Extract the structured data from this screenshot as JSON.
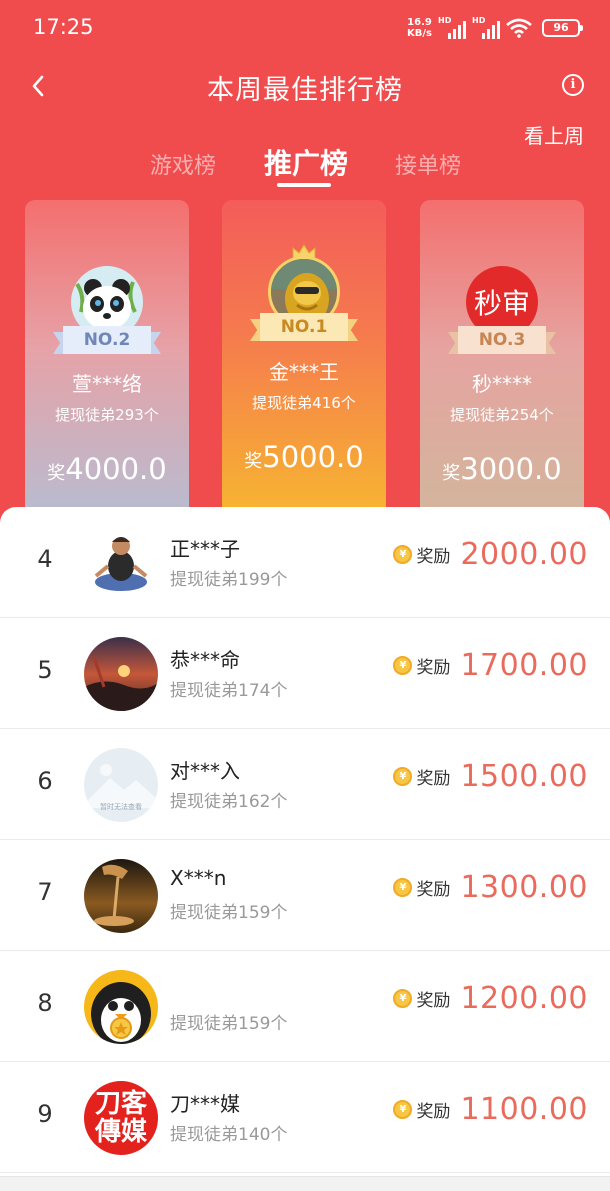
{
  "status_bar": {
    "time": "17:25",
    "net_speed_value": "16.9",
    "net_speed_unit": "KB/s",
    "signal_label_1": "HD",
    "signal_label_2": "HD",
    "battery": "96"
  },
  "header": {
    "title": "本周最佳排行榜",
    "last_week_label": "看上周",
    "info_glyph": "i"
  },
  "tabs": [
    {
      "label": "游戏榜",
      "active": false
    },
    {
      "label": "推广榜",
      "active": true
    },
    {
      "label": "接单榜",
      "active": false
    }
  ],
  "podium": {
    "second": {
      "badge": "NO.2",
      "name": "萱***络",
      "count": "提现徒弟293个",
      "prize_label": "奖",
      "prize": "4000.0",
      "avatar": "panda-avatar"
    },
    "first": {
      "badge": "NO.1",
      "name": "金***王",
      "count": "提现徒弟416个",
      "prize_label": "奖",
      "prize": "5000.0",
      "avatar": "golden-lion-avatar"
    },
    "third": {
      "badge": "NO.3",
      "name": "秒****",
      "count": "提现徒弟254个",
      "prize_label": "奖",
      "prize": "3000.0",
      "avatar_text": "秒审",
      "avatar": "red-text-avatar"
    }
  },
  "reward_label": "奖励",
  "coin_glyph": "¥",
  "ranking": [
    {
      "rank": "4",
      "name": "正***子",
      "count": "提现徒弟199个",
      "reward": "2000.00",
      "avatar": "meditating-figure-avatar"
    },
    {
      "rank": "5",
      "name": "恭***命",
      "count": "提现徒弟174个",
      "reward": "1700.00",
      "avatar": "sunset-landscape-avatar"
    },
    {
      "rank": "6",
      "name": "对***入",
      "count": "提现徒弟162个",
      "reward": "1500.00",
      "avatar": "placeholder-image-avatar",
      "avatar_caption": "暂时无法查看"
    },
    {
      "rank": "7",
      "name": "X***n",
      "count": "提现徒弟159个",
      "reward": "1300.00",
      "avatar": "sand-hand-avatar"
    },
    {
      "rank": "8",
      "name": "",
      "count": "提现徒弟159个",
      "reward": "1200.00",
      "avatar": "penguin-avatar"
    },
    {
      "rank": "9",
      "name": "刀***媒",
      "count": "提现徒弟140个",
      "reward": "1100.00",
      "avatar": "red-logo-avatar",
      "avatar_text_1": "刀客",
      "avatar_text_2": "傳媒"
    }
  ],
  "colors": {
    "header_red": "#f04b4d",
    "reward_text": "#ea6a5c",
    "coin_gold": "#f7c744"
  }
}
